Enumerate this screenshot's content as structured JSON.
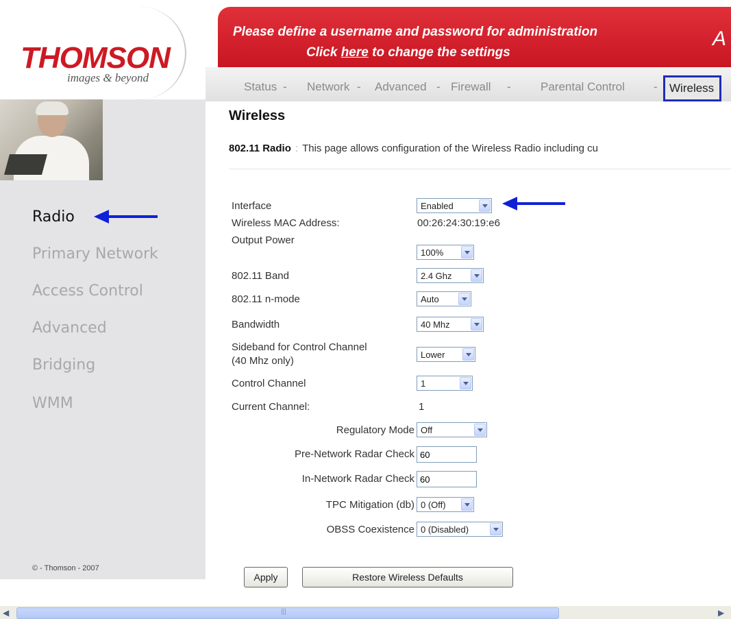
{
  "header": {
    "logo_text": "THOMSON",
    "logo_tagline": "images & beyond",
    "banner_line1": "Please define a username and password for administration",
    "banner_line2_prefix": "Click ",
    "banner_line2_link": "here",
    "banner_line2_suffix": " to change the settings",
    "banner_cut_text": "A"
  },
  "nav": {
    "items": [
      "Status",
      "Network",
      "Advanced",
      "Firewall",
      "Parental Control",
      "Wireless"
    ],
    "separator": "-",
    "active": "Wireless"
  },
  "sidebar": {
    "items": [
      "Radio",
      "Primary Network",
      "Access Control",
      "Advanced",
      "Bridging",
      "WMM"
    ],
    "active": "Radio",
    "copyright": "© - Thomson - 2007"
  },
  "main": {
    "title": "Wireless",
    "desc_label": "802.11 Radio",
    "desc_sep": ":",
    "desc_text": "This page allows configuration of the Wireless Radio including cu",
    "fields": {
      "interface": {
        "label": "Interface",
        "value": "Enabled"
      },
      "mac": {
        "label": "Wireless MAC Address:",
        "value": "00:26:24:30:19:e6"
      },
      "output_power": {
        "label": "Output Power",
        "value": "100%"
      },
      "band": {
        "label": "802.11 Band",
        "value": "2.4 Ghz"
      },
      "n_mode": {
        "label": "802.11 n-mode",
        "value": "Auto"
      },
      "bandwidth": {
        "label": "Bandwidth",
        "value": "40 Mhz"
      },
      "sideband": {
        "label_line1": "Sideband for Control Channel",
        "label_line2": "(40 Mhz only)",
        "value": "Lower"
      },
      "control_channel": {
        "label": "Control Channel",
        "value": "1"
      },
      "current_channel": {
        "label": "Current Channel:",
        "value": "1"
      },
      "regulatory_mode": {
        "label": "Regulatory Mode",
        "value": "Off"
      },
      "pre_radar": {
        "label": "Pre-Network Radar Check",
        "value": "60"
      },
      "in_radar": {
        "label": "In-Network Radar Check",
        "value": "60"
      },
      "tpc": {
        "label": "TPC Mitigation (db)",
        "value": "0 (Off)"
      },
      "obss": {
        "label": "OBSS Coexistence",
        "value": "0 (Disabled)"
      }
    },
    "apply_label": "Apply",
    "restore_label": "Restore Wireless Defaults"
  },
  "colors": {
    "brand_red": "#cc1a24",
    "highlight_blue": "#1f2cb8",
    "arrow_blue": "#1020d8"
  }
}
